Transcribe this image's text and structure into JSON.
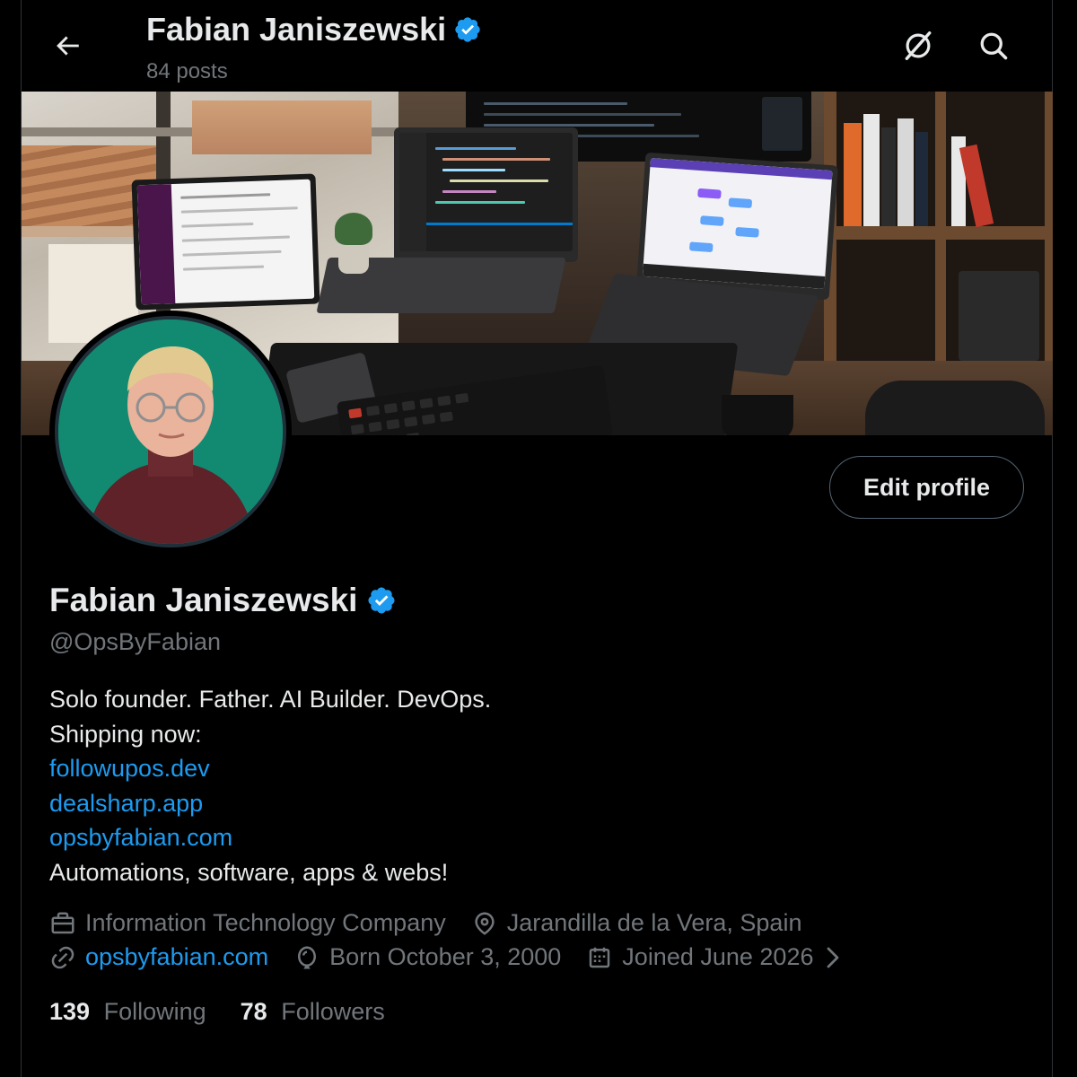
{
  "header": {
    "title": "Fabian Janiszewski",
    "posts": "84 posts"
  },
  "profile": {
    "name": "Fabian Janiszewski",
    "handle": "@OpsByFabian",
    "edit_label": "Edit profile",
    "bio_lines": [
      "Solo founder. Father. AI Builder. DevOps.",
      "Shipping now:"
    ],
    "bio_links": [
      "followupos.dev",
      "dealsharp.app",
      "opsbyfabian.com"
    ],
    "bio_tail": "Automations, software, apps & webs!",
    "category": "Information Technology Company",
    "location": "Jarandilla de la Vera, Spain",
    "website": "opsbyfabian.com",
    "born": "Born October 3, 2000",
    "joined": "Joined June 2026",
    "following_count": "139",
    "following_label": "Following",
    "followers_count": "78",
    "followers_label": "Followers"
  },
  "icons": {
    "back": "arrow-left-icon",
    "grok": "grok-icon",
    "search": "search-icon",
    "verified": "verified-badge-icon",
    "category": "briefcase-icon",
    "location": "map-pin-icon",
    "website": "link-icon",
    "born": "balloon-icon",
    "joined": "calendar-icon",
    "chevron": "chevron-right-icon"
  },
  "colors": {
    "background": "#000000",
    "text": "#e7e9ea",
    "secondary": "#71767b",
    "link": "#1d9bf0",
    "verified": "#1d9bf0",
    "border": "#2f3336"
  }
}
